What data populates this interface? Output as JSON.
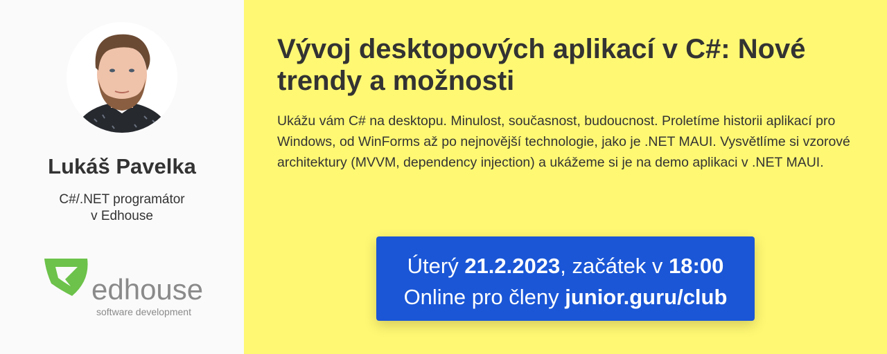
{
  "speaker": {
    "name": "Lukáš Pavelka",
    "role_line1": "C#/.NET programátor",
    "role_line2": "v Edhouse"
  },
  "company": {
    "name": "edhouse",
    "tagline": "software development",
    "brand_green": "#6cc24a",
    "brand_gray": "#8a8a8a"
  },
  "talk": {
    "title": "Vývoj desktopových aplikací v C#: Nové trendy a možnosti",
    "description": "Ukážu vám C# na desktopu. Minulost, současnost, budoucnost. Proletíme historii aplikací pro Windows, od WinForms až po nejnovější technologie, jako je .NET MAUI. Vysvětlíme si vzorové architektury (MVVM, dependency injection) a ukážeme si je na demo aplikaci v .NET MAUI."
  },
  "event": {
    "day": "Úterý",
    "date": "21.2.2023",
    "start_text": ", začátek v",
    "time": "18:00",
    "online_text": "Online pro členy",
    "url": "junior.guru/club"
  },
  "colors": {
    "left_bg": "#fafafa",
    "right_bg": "#fff873",
    "event_bg": "#1a56d6",
    "text": "#333333"
  }
}
